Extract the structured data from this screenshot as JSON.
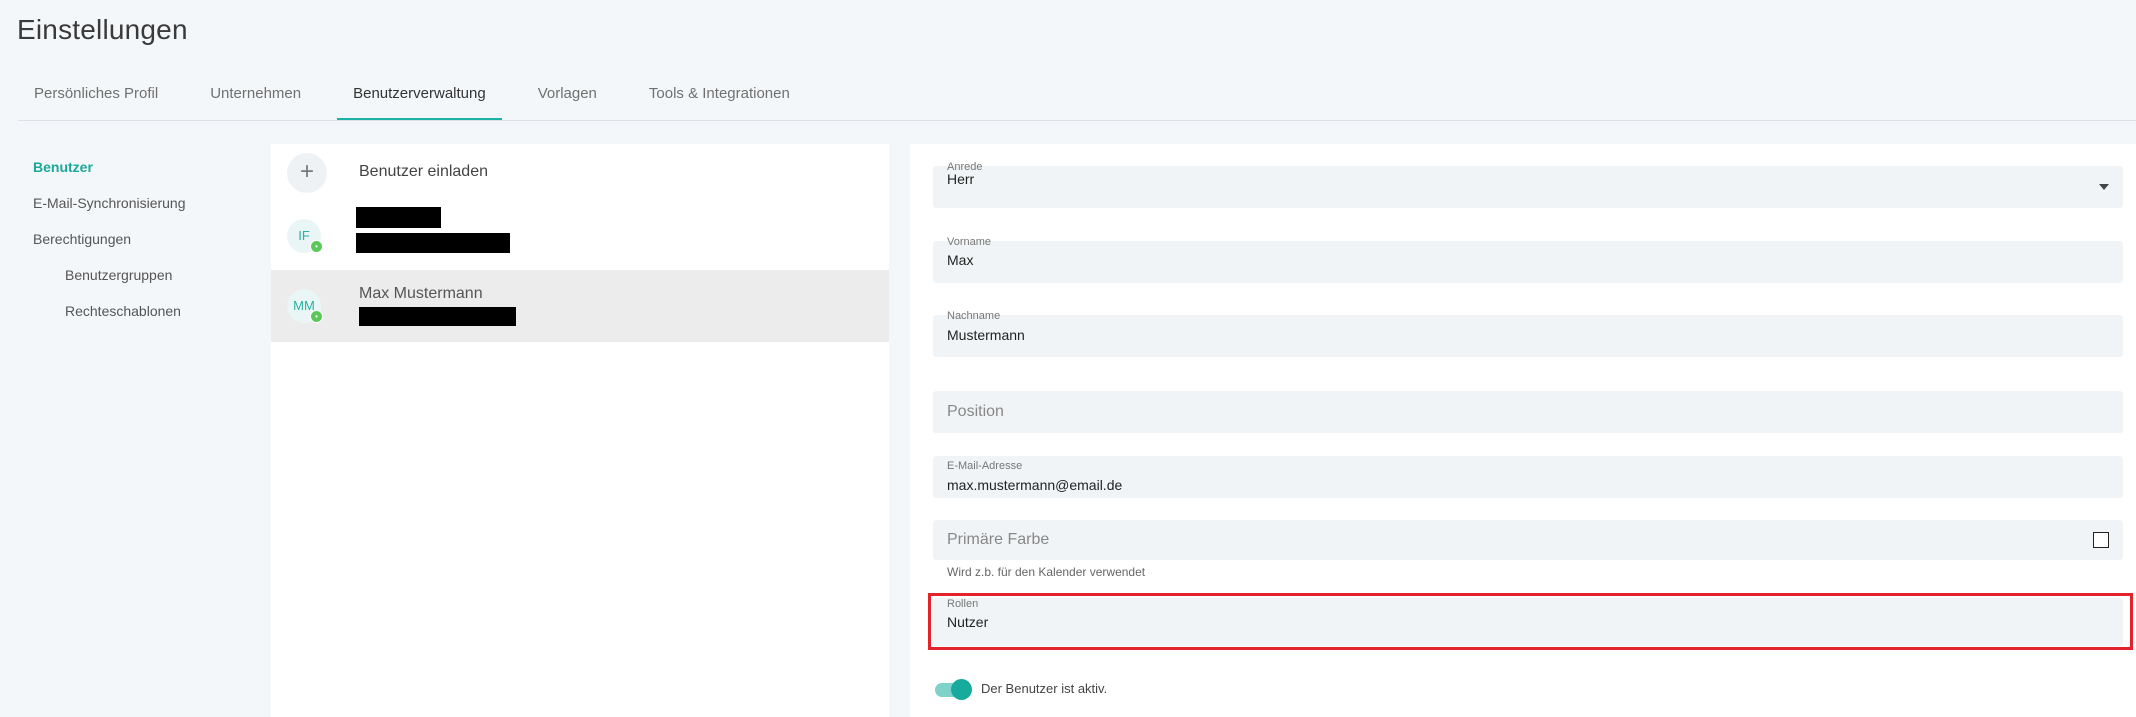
{
  "page_title": "Einstellungen",
  "tabs": [
    {
      "label": "Persönliches Profil"
    },
    {
      "label": "Unternehmen"
    },
    {
      "label": "Benutzerverwaltung"
    },
    {
      "label": "Vorlagen"
    },
    {
      "label": "Tools & Integrationen"
    }
  ],
  "active_tab": "Benutzerverwaltung",
  "sidebar": {
    "items": [
      {
        "label": "Benutzer"
      },
      {
        "label": "E-Mail-Synchronisierung"
      },
      {
        "label": "Berechtigungen"
      },
      {
        "label": "Benutzergruppen"
      },
      {
        "label": "Rechteschablonen"
      }
    ]
  },
  "userlist": {
    "invite_label": "Benutzer einladen",
    "users": [
      {
        "initials": "IF",
        "name": "",
        "status_icon": "online-dot"
      },
      {
        "initials": "MM",
        "name": "Max Mustermann",
        "status_icon": "online-dot"
      }
    ]
  },
  "form": {
    "anrede": {
      "label": "Anrede",
      "value": "Herr"
    },
    "vorname": {
      "label": "Vorname",
      "value": "Max"
    },
    "nachname": {
      "label": "Nachname",
      "value": "Mustermann"
    },
    "position": {
      "placeholder": "Position"
    },
    "email": {
      "label": "E-Mail-Adresse",
      "value": "max.mustermann@email.de"
    },
    "farbe": {
      "placeholder": "Primäre Farbe",
      "hint": "Wird z.b. für den Kalender verwendet"
    },
    "rollen": {
      "label": "Rollen",
      "value": "Nutzer"
    },
    "active_label": "Der Benutzer ist aktiv.",
    "active": true
  },
  "colors": {
    "accent": "#1ab3a6",
    "highlight": "#e3222c"
  }
}
